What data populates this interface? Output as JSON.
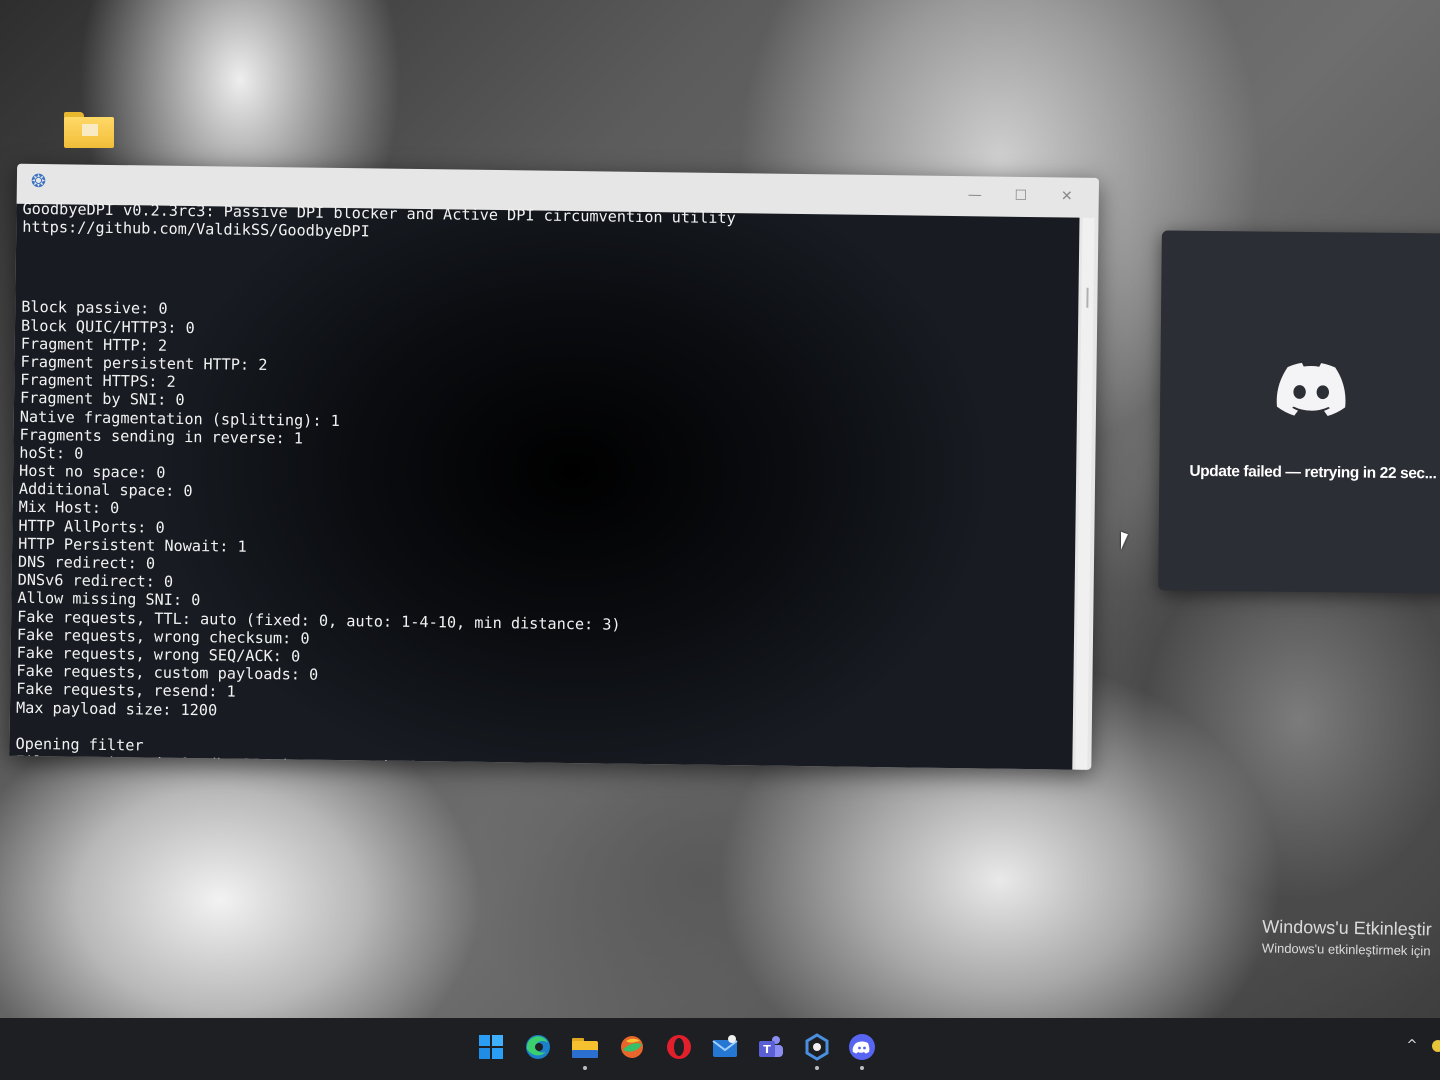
{
  "console": {
    "header_line1": "GoodbyeDPI v0.2.3rc3: Passive DPI blocker and Active DPI circumvention utility",
    "header_line2": "https://github.com/ValdikSS/GoodbyeDPI",
    "lines": [
      "",
      "",
      "Block passive: 0",
      "Block QUIC/HTTP3: 0",
      "Fragment HTTP: 2",
      "Fragment persistent HTTP: 2",
      "Fragment HTTPS: 2",
      "Fragment by SNI: 0",
      "Native fragmentation (splitting): 1",
      "Fragments sending in reverse: 1",
      "hoSt: 0",
      "Host no space: 0",
      "Additional space: 0",
      "Mix Host: 0",
      "HTTP AllPorts: 0",
      "HTTP Persistent Nowait: 1",
      "DNS redirect: 0",
      "DNSv6 redirect: 0",
      "Allow missing SNI: 0",
      "Fake requests, TTL: auto (fixed: 0, auto: 1-4-10, min distance: 3)",
      "Fake requests, wrong checksum: 0",
      "Fake requests, wrong SEQ/ACK: 0",
      "Fake requests, custom payloads: 0",
      "Fake requests, resend: 1",
      "Max payload size: 1200",
      "",
      "Opening filter",
      "Filter activated, GoodbyeDPI is now running!"
    ],
    "app_icon": "goodbyedpi-app-icon",
    "window_buttons": {
      "minimize": "—",
      "maximize": "☐",
      "close": "✕"
    }
  },
  "discord": {
    "message": "Update failed — retrying in 22 sec...",
    "icon": "discord-logo-icon",
    "background": "#2b2e34"
  },
  "watermark": {
    "title": "Windows'u Etkinleştir",
    "subtitle": "Windows'u etkinleştirmek için"
  },
  "taskbar": {
    "icons": [
      {
        "name": "windows-start-icon",
        "color": "#2a9df4",
        "running": false
      },
      {
        "name": "edge-browser-icon",
        "color": "#22a3d6",
        "running": false
      },
      {
        "name": "file-explorer-icon",
        "color": "#f5c12e",
        "running": true
      },
      {
        "name": "colorful-app-icon",
        "color": "#e8662c",
        "running": false
      },
      {
        "name": "opera-browser-icon",
        "color": "#e2202c",
        "running": false
      },
      {
        "name": "mail-app-icon",
        "color": "#2677d4",
        "running": false
      },
      {
        "name": "teams-app-icon",
        "color": "#6b6ee2",
        "running": false
      },
      {
        "name": "goodbyedpi-taskbar-icon",
        "color": "#4a8fe0",
        "running": true
      },
      {
        "name": "discord-taskbar-icon",
        "color": "#5865f2",
        "running": true
      }
    ],
    "tray_chevron": "^"
  },
  "colors": {
    "terminal_bg": "#0b0d11",
    "terminal_text": "#f2f2f2",
    "taskbar_bg": "#1d1f23"
  }
}
